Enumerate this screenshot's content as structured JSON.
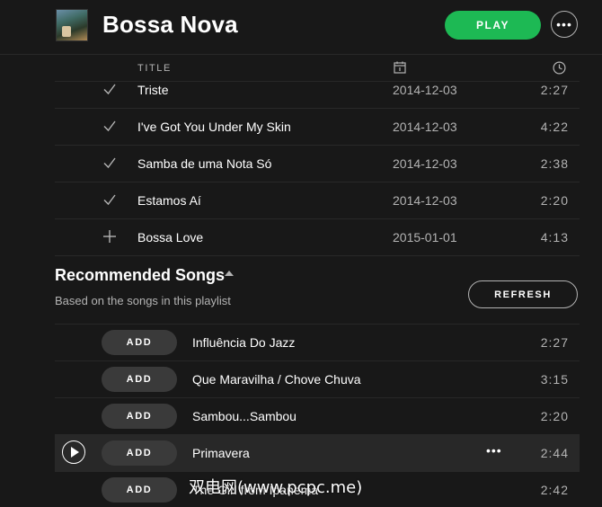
{
  "header": {
    "playlist_title": "Bossa Nova",
    "play_label": "PLAY",
    "more_label": "•••"
  },
  "columns": {
    "title_label": "TITLE",
    "date_icon": "calendar-icon",
    "duration_icon": "clock-icon"
  },
  "tracks": [
    {
      "title": "Triste",
      "date": "2014-12-03",
      "duration": "2:27",
      "status": "added"
    },
    {
      "title": "I've Got You Under My Skin",
      "date": "2014-12-03",
      "duration": "4:22",
      "status": "added"
    },
    {
      "title": "Samba de uma Nota Só",
      "date": "2014-12-03",
      "duration": "2:38",
      "status": "added"
    },
    {
      "title": "Estamos Aí",
      "date": "2014-12-03",
      "duration": "2:20",
      "status": "added"
    },
    {
      "title": "Bossa Love",
      "date": "2015-01-01",
      "duration": "4:13",
      "status": "not-added"
    }
  ],
  "recommended": {
    "heading": "Recommended Songs",
    "subtitle": "Based on the songs in this playlist",
    "refresh_label": "REFRESH",
    "add_label": "ADD",
    "row_more_label": "•••",
    "songs": [
      {
        "title": "Influência Do Jazz",
        "duration": "2:27"
      },
      {
        "title": "Que Maravilha / Chove Chuva",
        "duration": "3:15"
      },
      {
        "title": "Sambou...Sambou",
        "duration": "2:20"
      },
      {
        "title": "Primavera",
        "duration": "2:44"
      },
      {
        "title": "The Girl from Ipanema",
        "duration": "2:42"
      }
    ]
  },
  "watermark": "双电网(www.pcpc.me)",
  "colors": {
    "background": "#181818",
    "accent": "#1db954",
    "text_primary": "#ffffff",
    "text_secondary": "#b3b3b3",
    "divider": "#282828",
    "hover_row": "#282828"
  }
}
